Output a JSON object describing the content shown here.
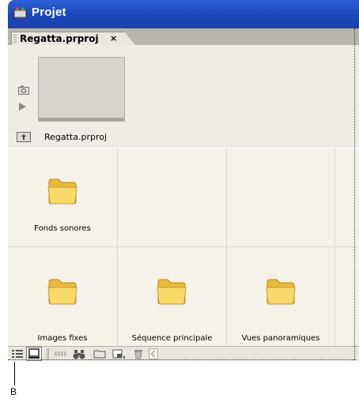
{
  "window": {
    "title": "Projet"
  },
  "tab": {
    "label": "Regatta.prproj",
    "close": "×"
  },
  "preview": {
    "project_name": "Regatta.prproj"
  },
  "bins": [
    {
      "name": "Fonds sonores"
    },
    {
      "name": ""
    },
    {
      "name": ""
    },
    {
      "name": "Images fixes"
    },
    {
      "name": "Séquence principale"
    },
    {
      "name": "Vues panoramiques"
    }
  ],
  "icons": {
    "app": "project-panel-icon",
    "camera": "camera-icon",
    "play": "play-icon",
    "up_folder": "parent-folder-icon",
    "folder": "folder-icon",
    "list_view": "list-view-icon",
    "icon_view": "icon-view-icon",
    "automate": "automate-to-sequence-icon",
    "find": "find-binoculars-icon",
    "new_bin": "new-bin-icon",
    "new_item": "new-item-icon",
    "clear": "trash-icon",
    "scroll_left": "scroll-left-icon"
  },
  "colors": {
    "titlebar": "#1f4fc6",
    "panel": "#f5f2ea",
    "folder": "#f4cf5a"
  },
  "callout": {
    "label": "B"
  }
}
